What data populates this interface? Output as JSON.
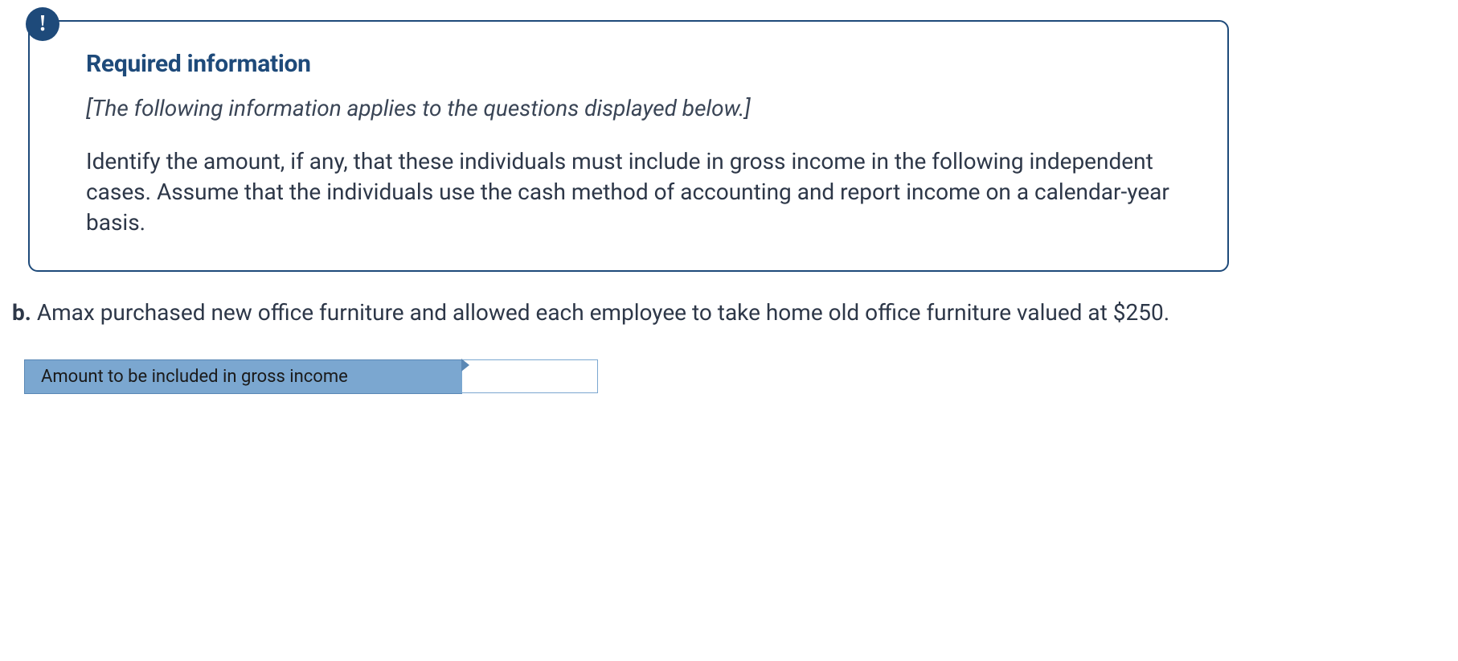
{
  "info_box": {
    "heading": "Required information",
    "subtitle": "[The following information applies to the questions displayed below.]",
    "body": "Identify the amount, if any, that these individuals must include in gross income in the following independent cases. Assume that the individuals use the cash method of accounting and report income on a calendar-year basis."
  },
  "question": {
    "label": "b.",
    "text": " Amax purchased new office furniture and allowed each employee to take home old office furniture valued at $250."
  },
  "answer": {
    "label": "Amount to be included in gross income",
    "value": ""
  }
}
